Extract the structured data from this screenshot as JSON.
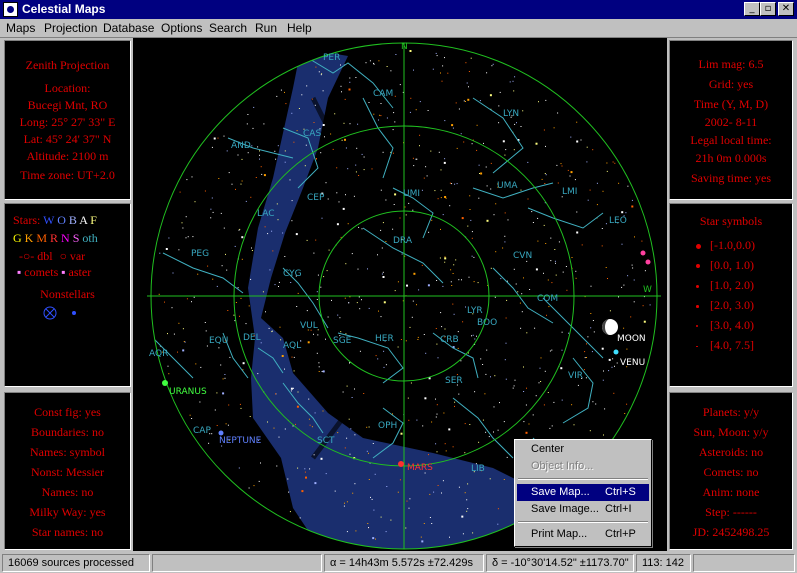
{
  "window": {
    "title": "Celestial Maps",
    "controls": {
      "minimize": "_",
      "maximize": "▫",
      "close": "✕"
    }
  },
  "menu": [
    "Maps",
    "Projection",
    "Database",
    "Options",
    "Search",
    "Run",
    "Help"
  ],
  "left_panel": {
    "projection": {
      "title": "Zenith Projection",
      "location_label": "Location:",
      "location": "Bucegi Mnt, RO",
      "long": "Long: 25° 27' 33\" E",
      "lat": "Lat:  45° 24' 37\" N",
      "altitude": "Altitude: 2100 m",
      "timezone": "Time zone: UT+2.0"
    },
    "legend": {
      "stars_label": "Stars:",
      "spectral": [
        {
          "letter": "W",
          "color": "#3050ff"
        },
        {
          "letter": "O",
          "color": "#6080ff"
        },
        {
          "letter": "B",
          "color": "#a0b0ff"
        },
        {
          "letter": "A",
          "color": "#ffffff"
        },
        {
          "letter": "F",
          "color": "#ffff80"
        }
      ],
      "spectral2": [
        {
          "letter": "G",
          "color": "#ffff00"
        },
        {
          "letter": "K",
          "color": "#ffa000"
        },
        {
          "letter": "M",
          "color": "#ff6000"
        },
        {
          "letter": "R",
          "color": "#ff3030"
        },
        {
          "letter": "N",
          "color": "#ff00ff"
        },
        {
          "letter": "S",
          "color": "#ff60ff"
        }
      ],
      "oth": "oth",
      "dbl": "dbl",
      "var": "var",
      "comets": "comets",
      "aster": "aster",
      "nonstellars": "Nonstellars"
    },
    "settings": {
      "const_fig": "Const fig: yes",
      "boundaries": "Boundaries: no",
      "names": "Names: symbol",
      "nonst": "Nonst: Messier",
      "names2": "Names: no",
      "milky_way": "Milky Way: yes",
      "star_names": "Star names: no"
    }
  },
  "right_panel": {
    "info": {
      "lim_mag": "Lim mag:  6.5",
      "grid": "Grid: yes",
      "time_label": "Time (Y, M, D)",
      "date": "2002- 8-11",
      "legal_label": "Legal local time:",
      "legal_time": "21h 0m 0.000s",
      "saving": "Saving time: yes"
    },
    "star_symbols": {
      "title": "Star symbols",
      "ranges": [
        "[-1.0,0.0)",
        "[0.0, 1.0)",
        "[1.0, 2.0)",
        "[2.0, 3.0)",
        "[3.0, 4.0)",
        "[4.0, 7.5]"
      ]
    },
    "status": {
      "planets": "Planets: y/y",
      "sun_moon": "Sun, Moon: y/y",
      "asteroids": "Asteroids: no",
      "comets": "Comets: no",
      "anim": "Anim: none",
      "step": "Step: ------",
      "jd": "JD: 2452498.25"
    }
  },
  "map": {
    "cardinals": {
      "n": "N",
      "w": "W",
      "s": "S",
      "e": "E"
    },
    "constellations": [
      "PER",
      "CAM",
      "LYN",
      "CAS",
      "AND",
      "UMI",
      "UMA",
      "LMI",
      "CEP",
      "LAC",
      "DRA",
      "LEO",
      "PEG",
      "CYG",
      "CVN",
      "COM",
      "VUL",
      "LYR",
      "BOO",
      "SGE",
      "EQU",
      "DEL",
      "AQL",
      "HER",
      "CRB",
      "VIR",
      "AQR",
      "SER",
      "OPH",
      "CAP",
      "SCT",
      "LIB"
    ],
    "objects": {
      "moon": "MOON",
      "venus": "VENU",
      "uranus": "URANUS",
      "neptune": "NEPTUNE",
      "mars": "MARS"
    },
    "colors": {
      "grid": "#20c020",
      "milky_way": "#1a2e6e",
      "constellation": "#40b0c0",
      "label": "#38a8c0"
    }
  },
  "context_menu": [
    {
      "label": "Center",
      "shortcut": "",
      "state": "normal"
    },
    {
      "label": "Object Info...",
      "shortcut": "",
      "state": "disabled"
    },
    {
      "label": "Save Map...",
      "shortcut": "Ctrl+S",
      "state": "selected"
    },
    {
      "label": "Save Image...",
      "shortcut": "Ctrl+I",
      "state": "normal"
    },
    {
      "label": "Print Map...",
      "shortcut": "Ctrl+P",
      "state": "normal"
    }
  ],
  "statusbar": {
    "sources": "16069 sources processed",
    "alpha": "α = 14h43m 5.572s ±72.429s",
    "delta": "δ = -10°30'14.52\" ±1173.70\"",
    "coords": "113: 142"
  }
}
